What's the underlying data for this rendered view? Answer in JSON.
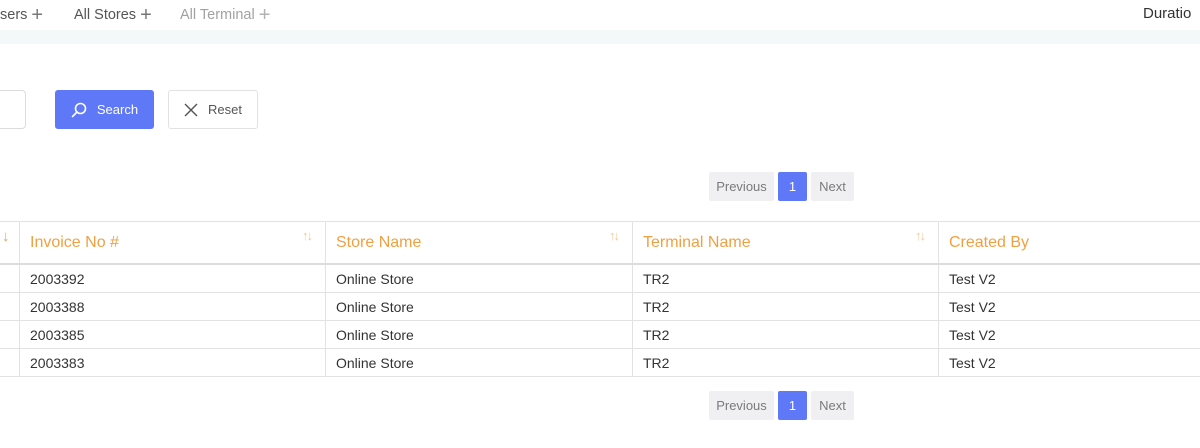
{
  "filters": [
    {
      "label": "sers",
      "state": "active"
    },
    {
      "label": "All Stores",
      "state": "active"
    },
    {
      "label": "All Terminal",
      "state": "disabled"
    }
  ],
  "duration_label": "Duratio",
  "actions": {
    "search_label": "Search",
    "search_icon": "search-icon",
    "reset_label": "Reset",
    "reset_icon": "close-icon"
  },
  "pagination": {
    "previous_label": "Previous",
    "current_page": "1",
    "next_label": "Next"
  },
  "table": {
    "columns": [
      "Invoice No #",
      "Store Name",
      "Terminal Name",
      "Created By"
    ],
    "rows": [
      [
        "2003392",
        "Online Store",
        "TR2",
        "Test V2"
      ],
      [
        "2003388",
        "Online Store",
        "TR2",
        "Test V2"
      ],
      [
        "2003385",
        "Online Store",
        "TR2",
        "Test V2"
      ],
      [
        "2003383",
        "Online Store",
        "TR2",
        "Test V2"
      ]
    ]
  },
  "colors": {
    "accent": "#5f78f8",
    "header_text": "#f0a043",
    "strip": "#f3f9f8"
  }
}
